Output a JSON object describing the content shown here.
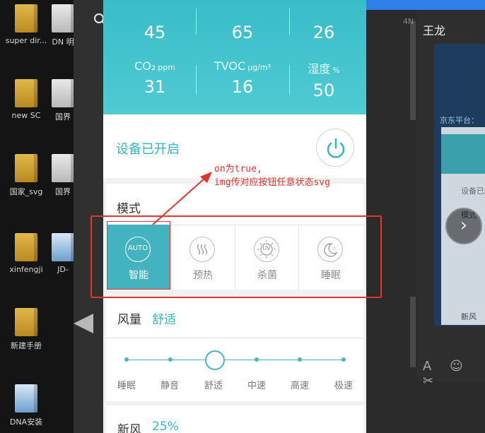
{
  "desktop": {
    "icons": [
      {
        "label": "super dir..."
      },
      {
        "label": "DN 明"
      },
      {
        "label": "new SC"
      },
      {
        "label": "国界"
      },
      {
        "label": "国家_svg"
      },
      {
        "label": "国界"
      },
      {
        "label": "xinfengji"
      },
      {
        "label": "JD-"
      },
      {
        "label": "新建手册"
      },
      {
        "label": "DNA安装"
      }
    ]
  },
  "chat": {
    "contact_name": "王龙",
    "platform_text": "京东平台：",
    "settings_text": "设备已开",
    "mode_text": "模式",
    "wind_text": "新风",
    "tools_text": "A ☺ ✂",
    "edge_text": "4N"
  },
  "app": {
    "metrics_top": [
      {
        "value": "45"
      },
      {
        "value": "65"
      },
      {
        "value": "26"
      }
    ],
    "metrics": [
      {
        "label": "CO₂",
        "unit": "ppm",
        "value": "31"
      },
      {
        "label": "TVOC",
        "unit": "μg/m³",
        "value": "16"
      },
      {
        "label": "湿度",
        "unit": "%",
        "value": "50"
      }
    ],
    "status": "设备已开启",
    "mode": {
      "title": "模式",
      "items": [
        {
          "icon": "auto-icon",
          "icon_text": "AUTO",
          "label": "智能",
          "active": true
        },
        {
          "icon": "preheat-icon",
          "icon_text": "",
          "label": "预热",
          "active": false
        },
        {
          "icon": "sterilize-icon",
          "icon_text": "UV",
          "label": "杀菌",
          "active": false
        },
        {
          "icon": "sleep-icon",
          "icon_text": "",
          "label": "睡眠",
          "active": false
        }
      ]
    },
    "wind": {
      "title": "风量",
      "value": "舒适",
      "levels": [
        "睡眠",
        "静音",
        "舒适",
        "中速",
        "高速",
        "极速"
      ],
      "selected_index": 2
    },
    "fresh": {
      "title": "新风",
      "value": "25%"
    }
  },
  "annotation": {
    "line1": "on为true,",
    "line2": "img传对应按钮任意状态svg"
  },
  "colors": {
    "accent": "#42b3bf",
    "header": "#44c3ce",
    "annotation": "#e5342f"
  }
}
